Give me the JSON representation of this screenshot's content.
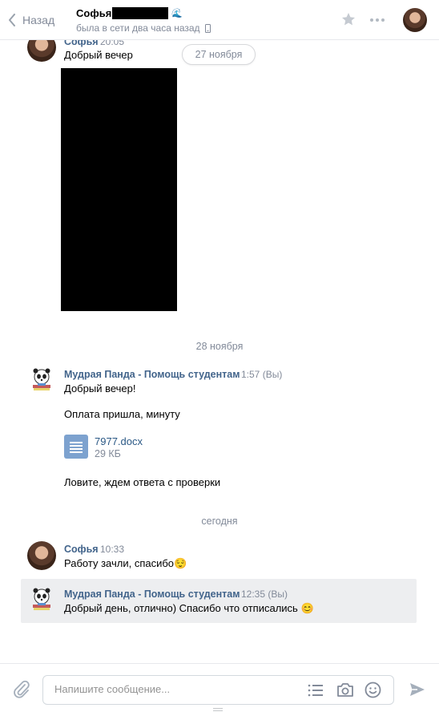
{
  "header": {
    "back_label": "Назад",
    "contact_name": "Софья",
    "status": "была в сети два часа назад"
  },
  "messages": [
    {
      "author": "Софья",
      "time": "20:05",
      "lines": [
        "Добрый вечер"
      ],
      "date_pill": "27 ноября"
    },
    {
      "date_separator": "28 ноября",
      "author": "Мудрая Панда - Помощь студентам",
      "time": "1:57",
      "you_mark": "(Вы)",
      "line1": "Добрый вечер!",
      "line2": "Оплата пришла, минуту",
      "attachment": {
        "name": "7977.docx",
        "size": "29 КБ"
      },
      "line3": "Ловите, ждем ответа с проверки"
    },
    {
      "date_separator": "сегодня",
      "author": "Софья",
      "time": "10:33",
      "text": "Работу зачли, спасибо😌"
    },
    {
      "author": "Мудрая Панда - Помощь студентам",
      "time": "12:35",
      "you_mark": "(Вы)",
      "text": "Добрый день, отлично) Спасибо что отписались 😊"
    }
  ],
  "composer": {
    "placeholder": "Напишите сообщение..."
  },
  "colors": {
    "link_blue": "#42648b",
    "meta_gray": "#828a99",
    "doc_blue": "#7da2cf",
    "highlight_bg": "#edeef0"
  },
  "icons": [
    "chevron-left-icon",
    "mobile-icon",
    "star-icon",
    "more-icon",
    "document-icon",
    "paperclip-icon",
    "list-icon",
    "camera-icon",
    "smile-icon",
    "send-icon"
  ]
}
